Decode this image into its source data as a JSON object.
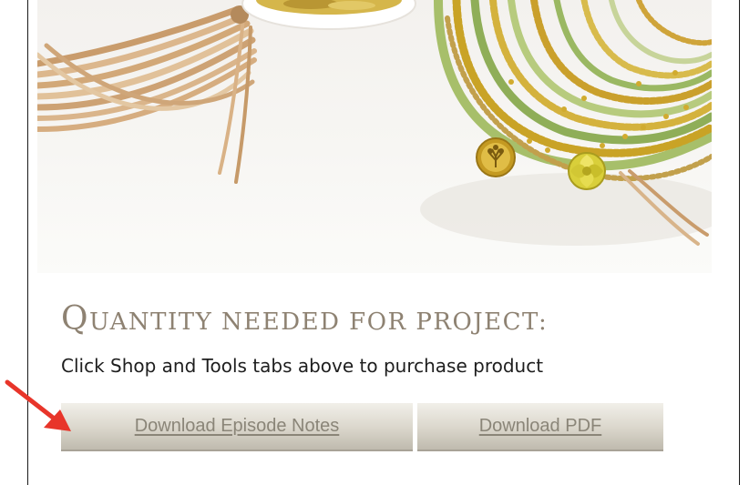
{
  "hero": {
    "image": "leather-and-beaded-wrap-bracelets",
    "icons": [
      "tree-of-life-charm-icon",
      "flower-button-clasp-icon"
    ]
  },
  "content": {
    "heading_first_letter": "Q",
    "heading_rest": "UANTITY NEEDED FOR PROJECT:",
    "subtext": "Click Shop and Tools tabs above to purchase product"
  },
  "buttons": {
    "episode_notes_label": "Download Episode Notes",
    "pdf_label": "Download PDF"
  },
  "annotation": {
    "arrow_color": "#e8352a",
    "points_to": "download-episode-notes-button"
  },
  "colors": {
    "heading": "#8e8272",
    "button_text": "#8a8578",
    "gold_beads": "#c9a326",
    "green_thread": "#8fae58",
    "leather": "#d8b48a"
  }
}
